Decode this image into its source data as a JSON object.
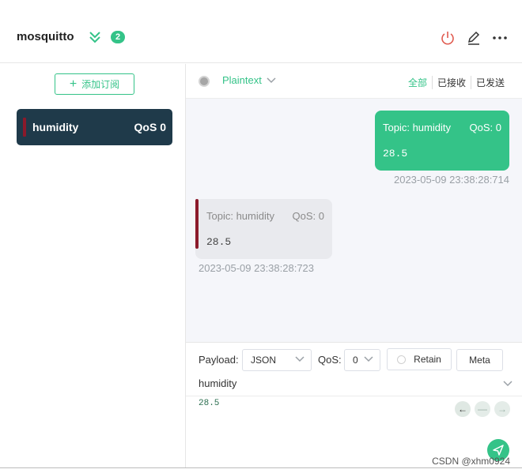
{
  "header": {
    "connection_name": "mosquitto",
    "badge_count": "2",
    "icons": [
      "chevrons-down-icon",
      "power-icon",
      "edit-icon",
      "more-icon"
    ],
    "colors": {
      "accent": "#34c388",
      "power": "#e05a4f"
    }
  },
  "sidebar": {
    "add_subscription_label": "添加订阅",
    "subscriptions": [
      {
        "topic": "humidity",
        "qos": "QoS 0",
        "color": "#8b1a2b"
      }
    ]
  },
  "toolbar": {
    "format": "Plaintext",
    "filters": {
      "all": "全部",
      "received": "已接收",
      "sent": "已发送"
    }
  },
  "messages": [
    {
      "direction": "out",
      "topic": "Topic: humidity",
      "qos": "QoS: 0",
      "payload": "28.5",
      "time": "2023-05-09 23:38:28:714"
    },
    {
      "direction": "in",
      "topic": "Topic: humidity",
      "qos": "QoS: 0",
      "payload": "28.5",
      "time": "2023-05-09 23:38:28:723"
    }
  ],
  "composer": {
    "payload_label": "Payload:",
    "payload_format": "JSON",
    "qos_label": "QoS:",
    "qos_value": "0",
    "retain_label": "Retain",
    "meta_label": "Meta",
    "topic": "humidity",
    "payload": "28.5"
  },
  "watermark": "CSDN @xhm0924"
}
